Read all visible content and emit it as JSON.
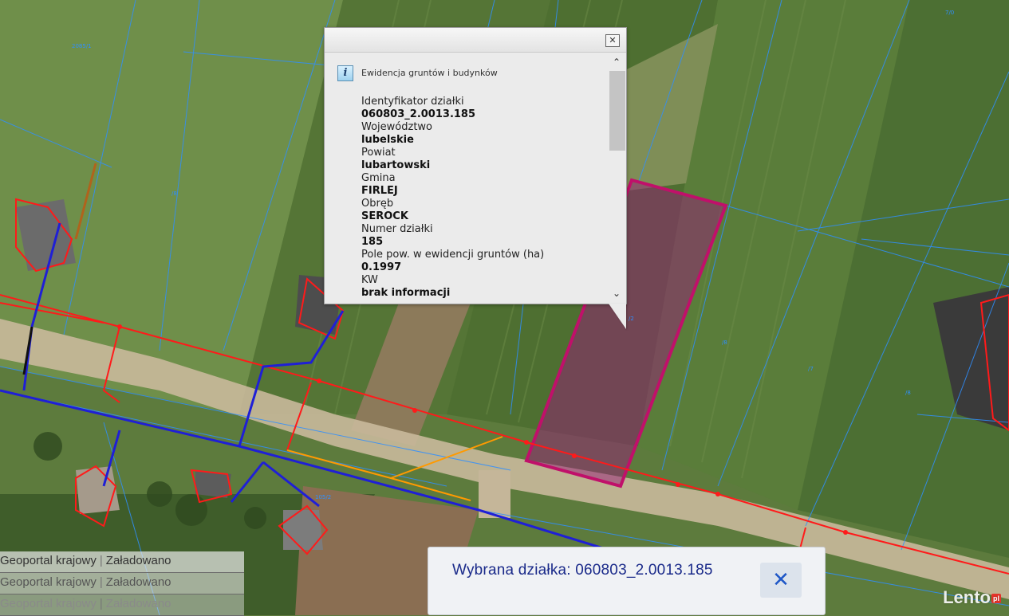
{
  "popup": {
    "section_title": "Ewidencja gruntów i budynków",
    "close_symbol": "✕",
    "scroll_up_symbol": "⌃",
    "scroll_down_symbol": "⌄",
    "fields": [
      {
        "label": "Identyfikator działki",
        "value": "060803_2.0013.185"
      },
      {
        "label": "Województwo",
        "value": "lubelskie"
      },
      {
        "label": "Powiat",
        "value": "lubartowski"
      },
      {
        "label": "Gmina",
        "value": "FIRLEJ"
      },
      {
        "label": "Obręb",
        "value": "SEROCK"
      },
      {
        "label": "Numer działki",
        "value": "185"
      },
      {
        "label": "Pole pow. w ewidencji gruntów (ha)",
        "value": "0.1997"
      },
      {
        "label": "KW",
        "value": "brak informacji"
      }
    ]
  },
  "selected_plot": {
    "text": "Wybrana działka: 060803_2.0013.185",
    "close_symbol": "✕"
  },
  "status_log": [
    {
      "source": "Geoportal krajowy",
      "status": "Załadowano"
    },
    {
      "source": "Geoportal krajowy",
      "status": "Załadowano"
    },
    {
      "source": "Geoportal krajowy",
      "status": "Załadowano"
    }
  ],
  "watermark": {
    "text": "Lento",
    "suffix": "pl"
  },
  "colors": {
    "parcel_highlight": "#c0106a",
    "cadastral_lines": "#2f8fff",
    "power_line": "#ff1a1a",
    "water_line": "#1f1fd6",
    "gas_line": "#ff9a00"
  }
}
